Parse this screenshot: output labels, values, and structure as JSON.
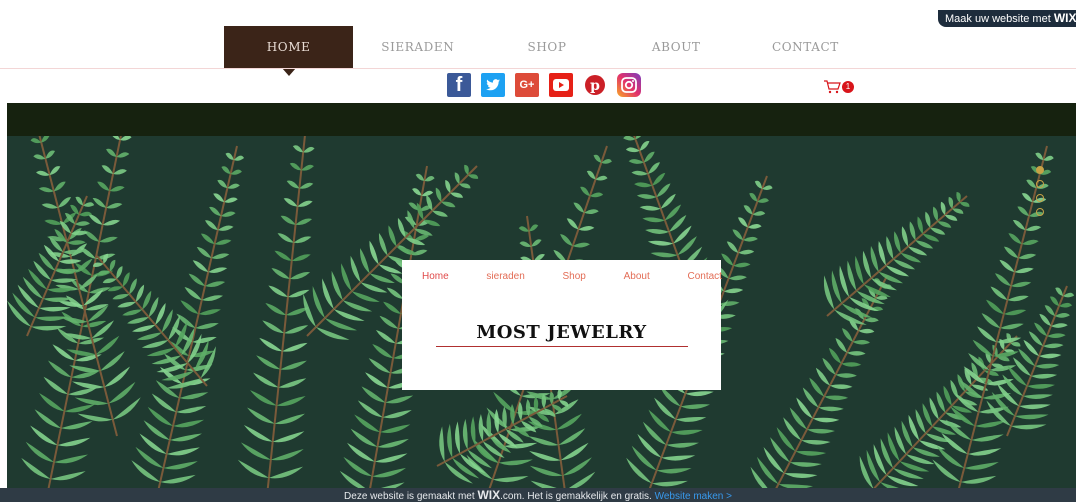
{
  "wix_badge": {
    "prefix": "Maak uw website met",
    "brand": "WIX"
  },
  "top_nav": [
    "Home",
    "Sieraden",
    "Shop",
    "About",
    "Contact"
  ],
  "social": [
    "facebook-icon",
    "twitter-icon",
    "google-plus-icon",
    "youtube-icon",
    "pinterest-icon",
    "instagram-icon"
  ],
  "social_glyphs": {
    "facebook": "f",
    "twitter": "t",
    "googleplus": "G+",
    "pinterest": "p"
  },
  "cart": {
    "count": "1"
  },
  "slides": {
    "total": 4,
    "current": 1
  },
  "card": {
    "nav": [
      "Home",
      "sieraden",
      "Shop",
      "About",
      "Contact"
    ],
    "title": "MOST JEWELRY"
  },
  "footer": {
    "text_before": "Deze website is gemaakt met",
    "brand": "WIX",
    "text_after": ".com. Het is gemakkelijk en gratis.",
    "cta": "Website maken >"
  },
  "colors": {
    "nav_active": "#3b2418",
    "accent_red": "#e04a4a",
    "hero_dark": "#16220f",
    "footer_bg": "#2f3b45",
    "footer_link": "#3899ec"
  }
}
